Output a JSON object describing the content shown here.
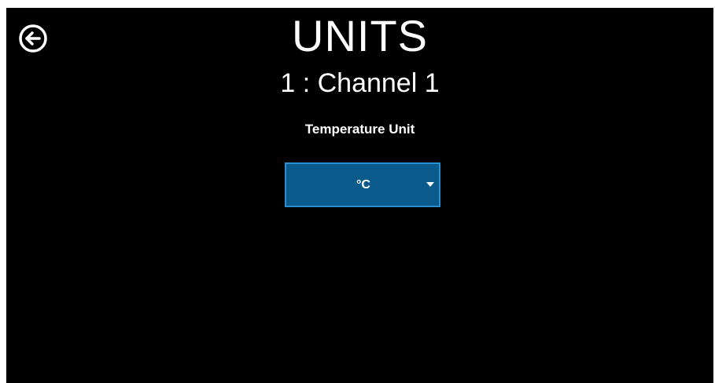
{
  "header": {
    "title": "UNITS",
    "subtitle": "1 : Channel 1",
    "back_icon": "arrow-left-circle-icon"
  },
  "temperature": {
    "label": "Temperature Unit",
    "selected": "°C",
    "caret_icon": "caret-down-icon"
  },
  "colors": {
    "background": "#000000",
    "select_fill": "#0a5a8c",
    "select_border": "#2a8fd0",
    "text": "#ffffff"
  }
}
